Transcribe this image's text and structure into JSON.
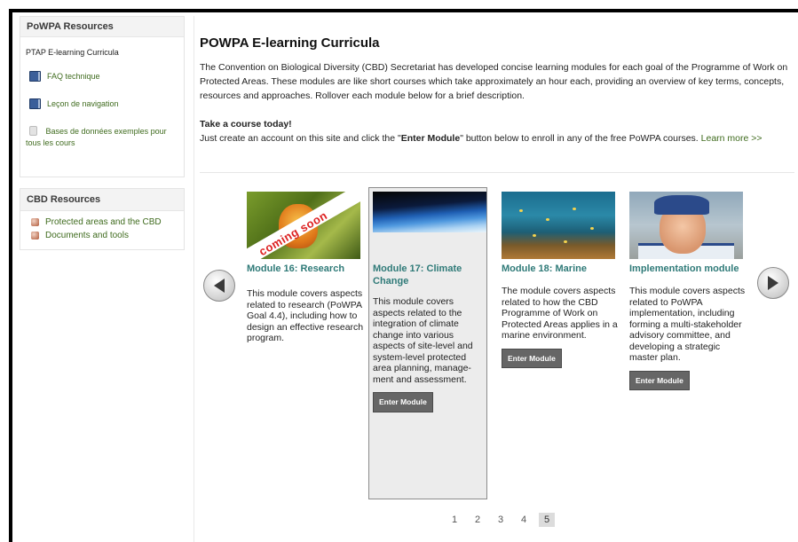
{
  "sidebar": {
    "powpa_box": {
      "title": "PoWPA Resources",
      "subtitle": "PTAP E-learning Curricula",
      "items": [
        {
          "label": "FAQ technique",
          "icon": "book-icon"
        },
        {
          "label": "Leçon de navigation",
          "icon": "book-icon"
        },
        {
          "label": "Bases de données exemples pour tous les cours",
          "icon": "database-icon"
        }
      ]
    },
    "cbd_box": {
      "title": "CBD Resources",
      "items": [
        {
          "label": "Protected areas and the CBD",
          "icon": "resource-icon"
        },
        {
          "label": "Documents and tools",
          "icon": "resource-icon"
        }
      ]
    }
  },
  "main": {
    "title": "POWPA E-learning Curricula",
    "intro": "The Convention on Biological Diversity (CBD) Secretariat has developed concise learning modules for each goal of the Programme of Work on Protected Areas. These modules are like short courses which take approximately an hour each, providing an overview of key terms, concepts, resources and approaches. Rollover each module below for a brief description.",
    "take_heading": "Take a course today!",
    "take_text_1": "Just create an account on this site and click the \"",
    "take_text_bold": "Enter Module",
    "take_text_2": "\" button below to enroll in any of the free PoWPA courses. ",
    "learn_more": "Learn more >>"
  },
  "carousel": {
    "prev_icon": "chevron-left-icon",
    "next_icon": "chevron-right-icon",
    "modules": [
      {
        "title": "Module 16: Research",
        "badge": "coming soon",
        "description": "This module covers aspects related to research (PoWPA Goal 4.4), including how to design an effective research program.",
        "button": ""
      },
      {
        "title": "Module 17: Climate Change",
        "description": "This module covers aspects related to the integration of climate change into various aspects of site-level and system-level protected area planning, manage-ment and assessment.",
        "button": "Enter Module"
      },
      {
        "title": "Module 18: Marine",
        "description": "The module covers aspects related to how the CBD Programme of Work on Protected Areas applies in a marine environment.",
        "button": "Enter Module"
      },
      {
        "title": "Implementation module",
        "description": "This module covers aspects related to PoWPA implementation, including forming a multi-stakeholder advisory committee, and developing a strategic master plan.",
        "button": "Enter Module"
      }
    ]
  },
  "pager": {
    "pages": [
      "1",
      "2",
      "3",
      "4",
      "5"
    ],
    "current": "5"
  },
  "colors": {
    "link_green": "#3f6b1e",
    "module_title_teal": "#2f7a78",
    "button_gray": "#666666"
  }
}
